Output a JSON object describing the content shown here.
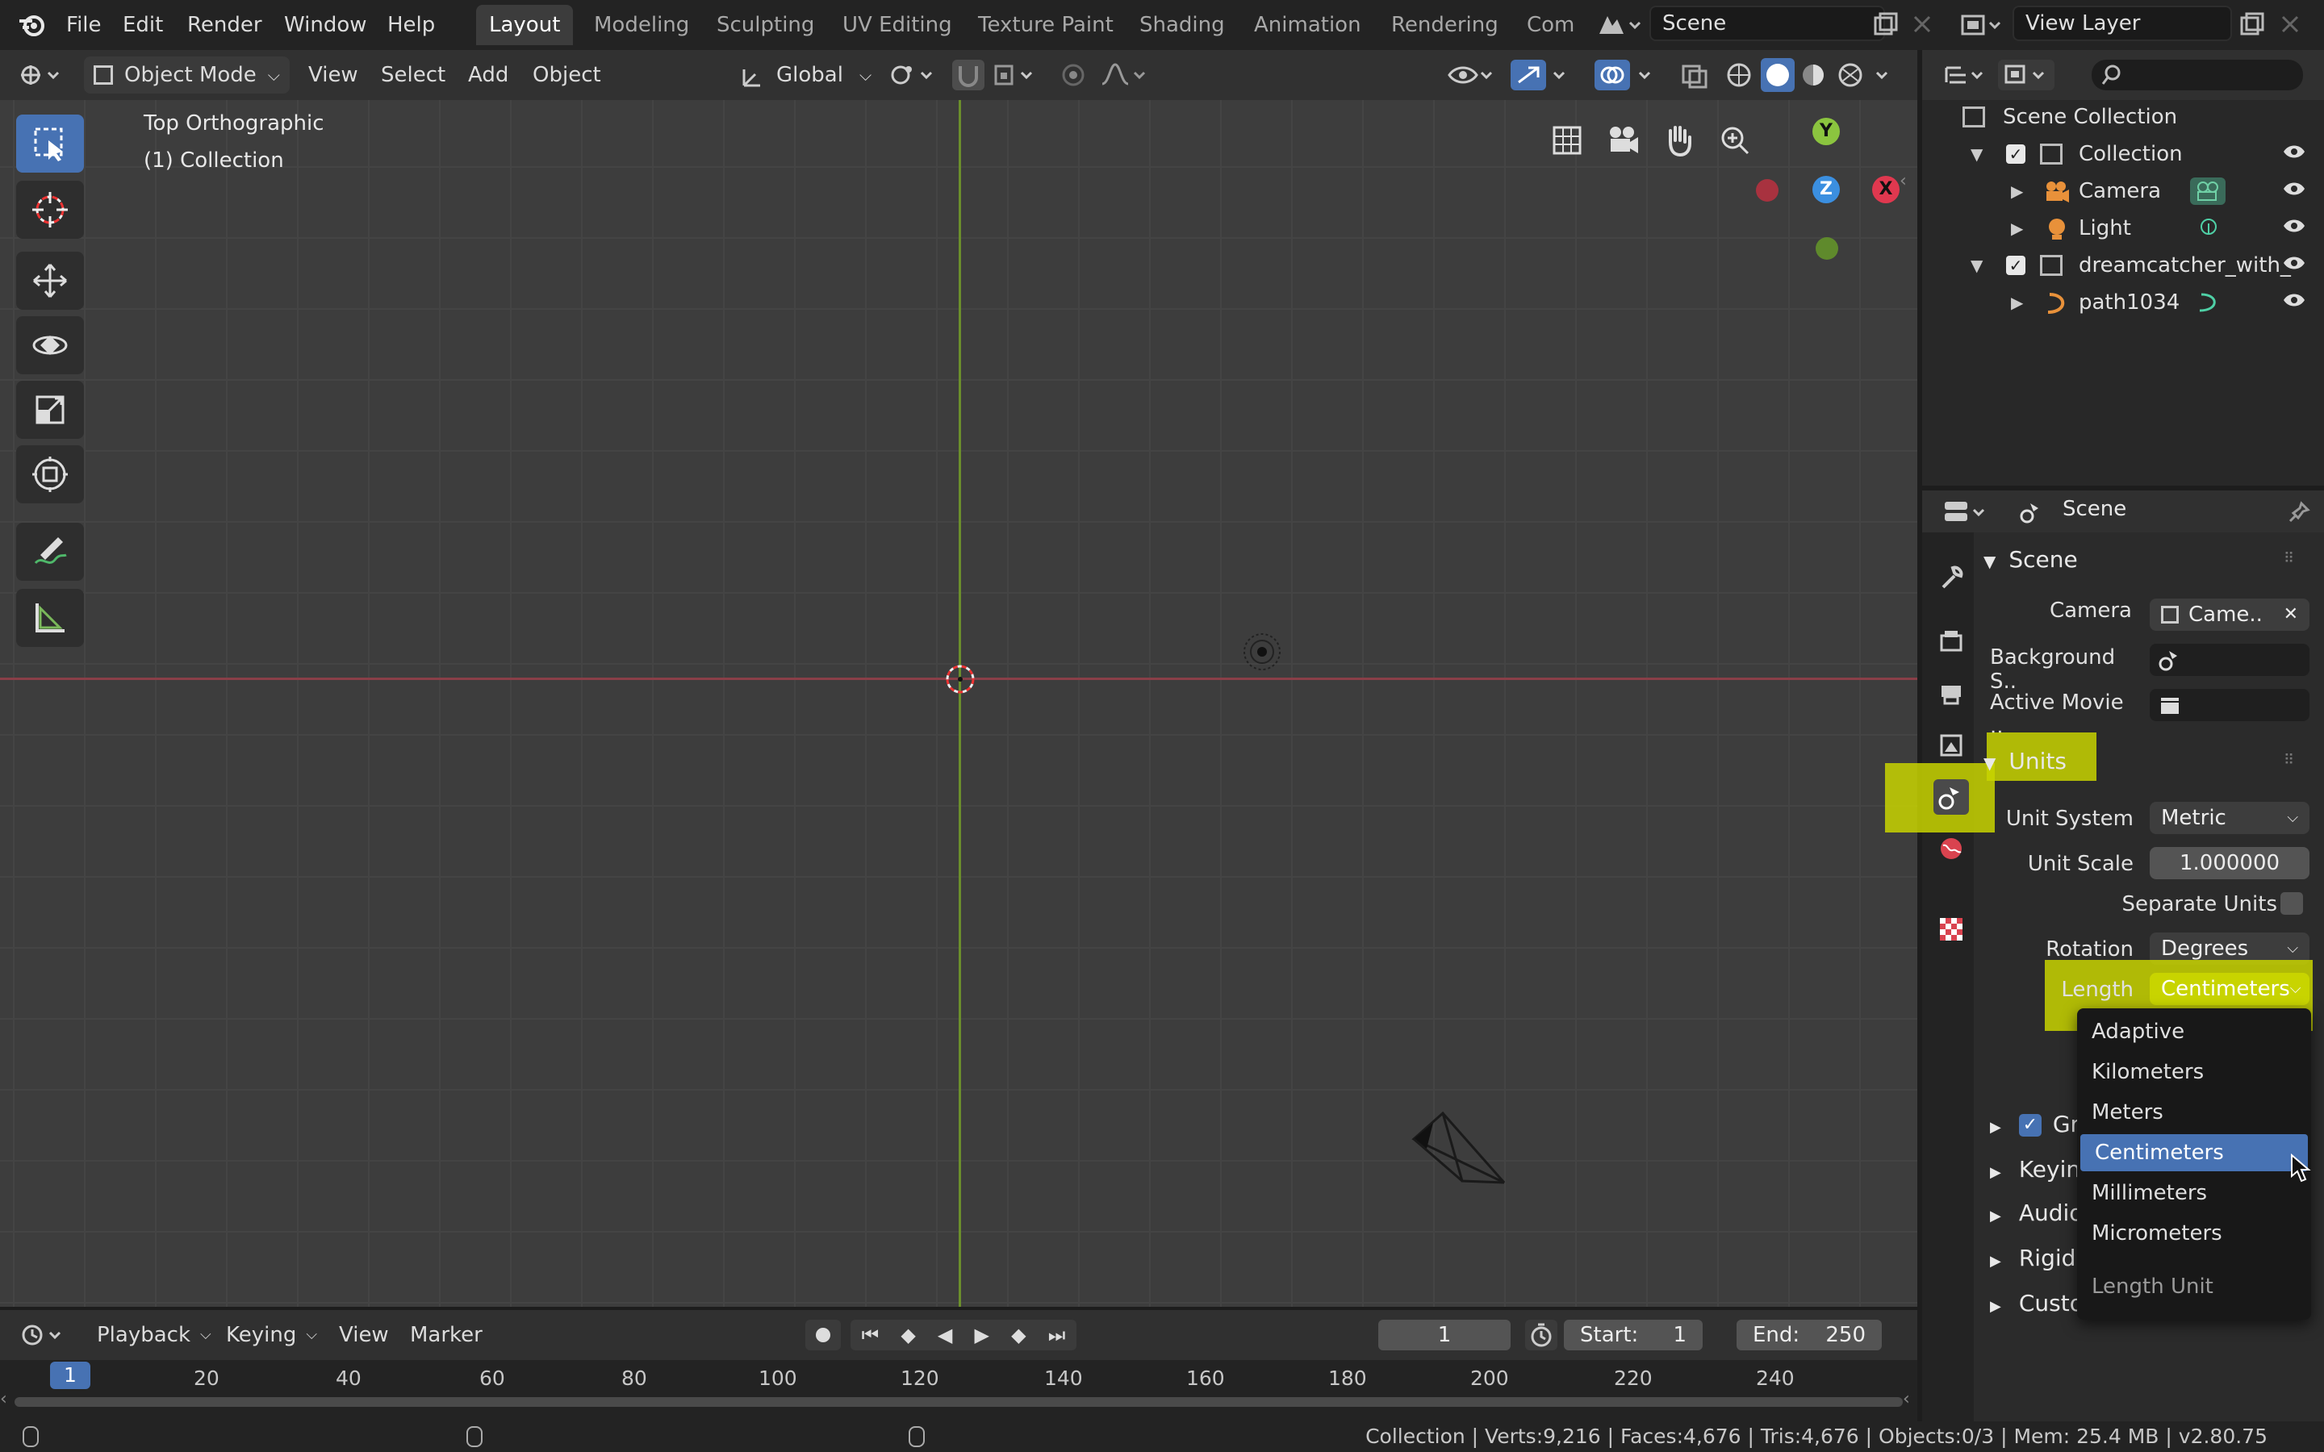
{
  "topbar": {
    "menus": [
      "File",
      "Edit",
      "Render",
      "Window",
      "Help"
    ],
    "workspaces": [
      "Layout",
      "Modeling",
      "Sculpting",
      "UV Editing",
      "Texture Paint",
      "Shading",
      "Animation",
      "Rendering",
      "Com"
    ],
    "active_workspace": "Layout",
    "scene_name": "Scene",
    "view_layer_name": "View Layer"
  },
  "viewport_header": {
    "mode": "Object Mode",
    "menus": [
      "View",
      "Select",
      "Add",
      "Object"
    ],
    "transform_orientation": "Global"
  },
  "viewport": {
    "view_name": "Top Orthographic",
    "collection_label": "(1) Collection",
    "gizmo_axes": {
      "y": "Y",
      "z": "Z",
      "x": "X"
    }
  },
  "outliner": {
    "root": "Scene Collection",
    "rows": [
      {
        "label": "Collection"
      },
      {
        "label": "Camera"
      },
      {
        "label": "Light"
      },
      {
        "label": "dreamcatcher_with_"
      },
      {
        "label": "path1034"
      }
    ]
  },
  "properties": {
    "context_title": "Scene",
    "scene_panel": {
      "title": "Scene",
      "camera_label": "Camera",
      "camera_value": "Came..",
      "background_label": "Background S..",
      "movie_label": "Active Movie .."
    },
    "units_panel": {
      "title": "Units",
      "unit_system_label": "Unit System",
      "unit_system_value": "Metric",
      "unit_scale_label": "Unit Scale",
      "unit_scale_value": "1.000000",
      "separate_units_label": "Separate Units",
      "rotation_label": "Rotation",
      "rotation_value": "Degrees",
      "length_label": "Length",
      "length_value": "Centimeters"
    },
    "collapsed_panels": [
      "Gr",
      "Keyin",
      "Audio",
      "Rigid",
      "Custo"
    ]
  },
  "length_dropdown": {
    "items": [
      "Adaptive",
      "Kilometers",
      "Meters",
      "Centimeters",
      "Millimeters",
      "Micrometers"
    ],
    "selected": "Centimeters",
    "footer": "Length Unit"
  },
  "timeline": {
    "menus": [
      "Playback",
      "Keying",
      "View",
      "Marker"
    ],
    "current_frame": "1",
    "start_label": "Start:",
    "start_value": "1",
    "end_label": "End:",
    "end_value": "250",
    "ticks": [
      "1",
      "20",
      "40",
      "60",
      "80",
      "100",
      "120",
      "140",
      "160",
      "180",
      "200",
      "220",
      "240"
    ]
  },
  "statusbar": {
    "text": "Collection | Verts:9,216 | Faces:4,676 | Tris:4,676 | Objects:0/3 | Mem: 25.4 MB | v2.80.75"
  },
  "colors": {
    "accent_blue": "#4772b3",
    "highlight_yellow": "#c8d400",
    "x_axis": "#e0384f",
    "y_axis": "#8bc43f",
    "z_axis": "#3b8fe0"
  }
}
